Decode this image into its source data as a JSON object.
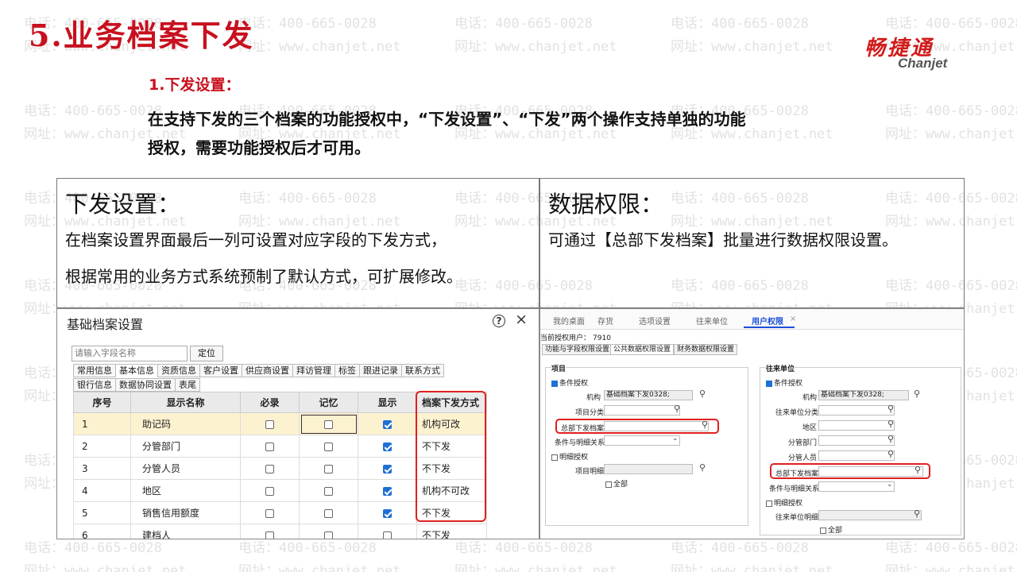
{
  "slide": {
    "title": "5.业务档案下发",
    "subtitle": "1.下发设置：",
    "intro": "在支持下发的三个档案的功能授权中，“下发设置”、“下发”两个操作支持单独的功能授权，需要功能授权后才可用。",
    "logo_cn": "畅捷通",
    "logo_en": "Chanjet",
    "watermark_phone": "电话：400-665-0028",
    "watermark_site": "网址：www.chanjet.net"
  },
  "left_box": {
    "heading": "下发设置：",
    "line1": "在档案设置界面最后一列可设置对应字段的下发方式，",
    "line2": "根据常用的业务方式系统预制了默认方式，可扩展修改。"
  },
  "right_box": {
    "heading": "数据权限：",
    "line1": "可通过【总部下发档案】批量进行数据权限设置。"
  },
  "dialog": {
    "title": "基础档案设置",
    "help_icon": "?",
    "close_icon": "×",
    "search_placeholder": "请输入字段名称",
    "locate_button": "定位",
    "tabs": [
      "常用信息",
      "基本信息",
      "资质信息",
      "客户设置",
      "供应商设置",
      "拜访管理",
      "标签",
      "跟进记录",
      "联系方式",
      "银行信息",
      "数据协同设置",
      "表尾"
    ],
    "active_tab": "基本信息",
    "columns": [
      "序号",
      "显示名称",
      "必录",
      "记忆",
      "显示",
      "档案下发方式"
    ],
    "rows": [
      {
        "no": "1",
        "name": "助记码",
        "required": false,
        "memory": false,
        "show": true,
        "mode": "机构可改"
      },
      {
        "no": "2",
        "name": "分管部门",
        "required": false,
        "memory": false,
        "show": true,
        "mode": "不下发"
      },
      {
        "no": "3",
        "name": "分管人员",
        "required": false,
        "memory": false,
        "show": true,
        "mode": "不下发"
      },
      {
        "no": "4",
        "name": "地区",
        "required": false,
        "memory": false,
        "show": true,
        "mode": "机构不可改"
      },
      {
        "no": "5",
        "name": "销售信用额度",
        "required": false,
        "memory": false,
        "show": true,
        "mode": "不下发"
      },
      {
        "no": "6",
        "name": "建档人",
        "required": false,
        "memory": false,
        "show": false,
        "mode": "不下发"
      }
    ],
    "colors": {
      "highlight": "#e02020",
      "selected_row": "#fdf2d0",
      "check": "#1e6fd6"
    }
  },
  "user_auth": {
    "nav": [
      "我的桌面",
      "存货",
      "选项设置",
      "往来单位",
      "用户权限"
    ],
    "active_nav": "用户权限",
    "current_user_label": "当前授权用户：",
    "current_user": "7910",
    "tabs": [
      "功能与字段权限设置",
      "公共数据权限设置",
      "财务数据权限设置"
    ],
    "project": {
      "group_title": "项目",
      "cond_auth": "条件授权",
      "org_label": "机构",
      "org_value": "基础档案下发0328;",
      "class_label": "项目分类",
      "hq_label": "总部下发档案",
      "relation_label": "条件与明细关系",
      "detail_auth": "明细授权",
      "detail_label": "项目明细",
      "all": "全部"
    },
    "partner": {
      "group_title": "往来单位",
      "cond_auth": "条件授权",
      "org_label": "机构",
      "org_value": "基础档案下发0328;",
      "class_label": "往来单位分类",
      "region_label": "地区",
      "dept_label": "分管部门",
      "staff_label": "分管人员",
      "hq_label": "总部下发档案",
      "relation_label": "条件与明细关系",
      "detail_auth": "明细授权",
      "detail_label": "往来单位明细",
      "all": "全部"
    }
  }
}
